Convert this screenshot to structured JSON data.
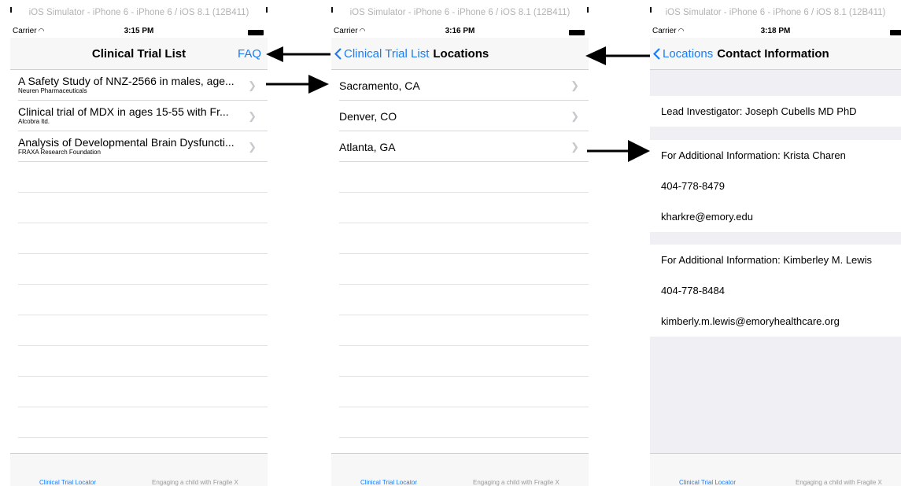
{
  "simulator_title": "iOS Simulator - iPhone 6 - iPhone 6 / iOS 8.1 (12B411)",
  "carrier": "Carrier",
  "screen1": {
    "time": "3:15 PM",
    "nav_title": "Clinical Trial List",
    "nav_right": "FAQ",
    "trials": [
      {
        "title": "A Safety Study of NNZ-2566 in males, age...",
        "sponsor": "Neuren Pharmaceuticals"
      },
      {
        "title": "Clinical trial of MDX in ages 15-55 with Fr...",
        "sponsor": "Alcobra ltd."
      },
      {
        "title": "Analysis of Developmental Brain Dysfuncti...",
        "sponsor": "FRAXA Research Foundation"
      }
    ]
  },
  "screen2": {
    "time": "3:16 PM",
    "back_label": "Clinical Trial List",
    "nav_title": "Locations",
    "locations": [
      "Sacramento, CA",
      "Denver, CO",
      "Atlanta, GA"
    ]
  },
  "screen3": {
    "time": "3:18 PM",
    "back_label": "Locations",
    "nav_title": "Contact Information",
    "lead": "Lead Investigator: Joseph Cubells MD PhD",
    "contact1": {
      "info": "For Additional Information: Krista Charen",
      "phone": "404-778-8479",
      "email": "kharkre@emory.edu"
    },
    "contact2": {
      "info": "For Additional Information: Kimberley M. Lewis",
      "phone": "404-778-8484",
      "email": "kimberly.m.lewis@emoryhealthcare.org"
    }
  },
  "tabs": {
    "left": "Clinical Trial Locator",
    "right": "Engaging a child with Fragile X"
  },
  "colors": {
    "accent": "#1a7cf6",
    "group_bg": "#efeff4",
    "bar_bg": "#f7f7f7"
  },
  "icons": [
    "wifi-icon",
    "battery-icon",
    "chevron-right-icon",
    "back-chevron-icon",
    "arrow-icon"
  ]
}
